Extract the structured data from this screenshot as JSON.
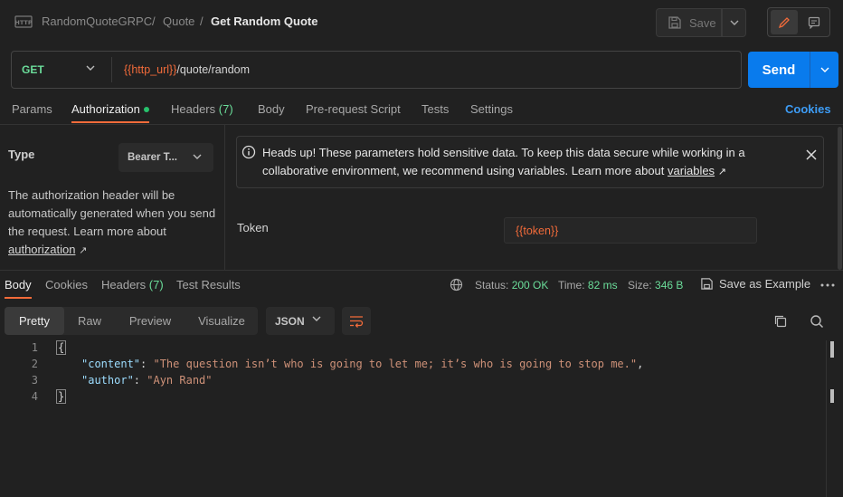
{
  "breadcrumb": {
    "collection": "RandomQuoteGRPC",
    "folder": "Quote",
    "request": "Get Random Quote",
    "separator": "/"
  },
  "toolbar": {
    "save_label": "Save"
  },
  "request": {
    "method": "GET",
    "url_variable": "{{http_url}}",
    "url_path": "/quote/random",
    "send_label": "Send"
  },
  "request_tabs": [
    {
      "label": "Params",
      "count": ""
    },
    {
      "label": "Authorization",
      "count": ""
    },
    {
      "label": "Headers",
      "count": "(7)"
    },
    {
      "label": "Body",
      "count": ""
    },
    {
      "label": "Pre-request Script",
      "count": ""
    },
    {
      "label": "Tests",
      "count": ""
    },
    {
      "label": "Settings",
      "count": ""
    }
  ],
  "cookies_label": "Cookies",
  "auth": {
    "type_label": "Type",
    "type_value": "Bearer T...",
    "description": "The authorization header will be automatically generated when you send the request. Learn more about",
    "description_link": "authorization",
    "alert_text": "Heads up! These parameters hold sensitive data. To keep this data secure while working in a collaborative environment, we recommend using variables. Learn more about",
    "alert_link": "variables",
    "token_label": "Token",
    "token_value": "{{token}}"
  },
  "response_tabs": [
    {
      "label": "Body",
      "count": ""
    },
    {
      "label": "Cookies",
      "count": ""
    },
    {
      "label": "Headers",
      "count": "(7)"
    },
    {
      "label": "Test Results",
      "count": ""
    }
  ],
  "response_meta": {
    "status_label": "Status:",
    "status_value": "200 OK",
    "time_label": "Time:",
    "time_value": "82 ms",
    "size_label": "Size:",
    "size_value": "346 B",
    "save_example_label": "Save as Example"
  },
  "format": {
    "modes": [
      "Pretty",
      "Raw",
      "Preview",
      "Visualize"
    ],
    "active_mode": "Pretty",
    "language": "JSON"
  },
  "response_body": {
    "line_numbers": [
      "1",
      "2",
      "3",
      "4"
    ],
    "open_brace": "{",
    "close_brace": "}",
    "fields": [
      {
        "key": "\"content\"",
        "value": "\"The question isn’t who is going to let me; it’s who is going to stop me.\"",
        "trail": ","
      },
      {
        "key": "\"author\"",
        "value": "\"Ayn Rand\"",
        "trail": ""
      }
    ]
  },
  "colors": {
    "accent": "#f26b3a",
    "send_blue": "#097bed",
    "success_green": "#6bdd9a",
    "link_blue": "#3d9cf5"
  },
  "icons": [
    "http-icon",
    "save-icon",
    "chevron-down-icon",
    "pencil-icon",
    "comment-icon",
    "info-icon",
    "close-icon",
    "external-link-icon",
    "globe-icon",
    "save-example-icon",
    "more-icon",
    "wrap-icon",
    "copy-icon",
    "search-icon"
  ]
}
